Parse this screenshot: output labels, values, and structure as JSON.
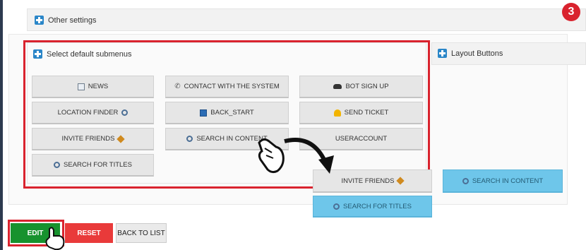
{
  "panels": {
    "other_settings": "Other settings",
    "select_default_submenus": "Select default submenus",
    "layout_buttons": "Layout Buttons"
  },
  "step_badge": "3",
  "submenus": {
    "news": "NEWS",
    "contact": "CONTACT WITH THE SYSTEM",
    "bot_signup": "BOT SIGN UP",
    "location_finder": "LOCATION FINDER",
    "back_start": "BACK_START",
    "send_ticket": "SEND TICKET",
    "invite_friends": "INVITE FRIENDS",
    "search_in_content": "SEARCH IN CONTENT",
    "useraccount": "USERACCOUNT",
    "search_for_titles": "SEARCH FOR TITLES"
  },
  "layout": {
    "invite_friends": "INVITE FRIENDS",
    "search_in_content": "SEARCH IN CONTENT",
    "search_for_titles": "SEARCH FOR TITLES"
  },
  "actions": {
    "edit": "EDIT",
    "reset": "RESET",
    "back_to_list": "BACK TO LIST"
  },
  "colors": {
    "accent_red": "#d9232e",
    "edit_green": "#17922e",
    "reset_red": "#e93a3a",
    "selected_blue": "#6ec6ea",
    "icon_blue": "#2a86c8"
  },
  "icons": [
    "plus-icon",
    "news-icon",
    "contact-icon",
    "bot-icon",
    "magnifier-icon",
    "back-icon",
    "bell-icon",
    "gift-icon",
    "hand-pointer-icon",
    "drag-arrow-icon"
  ]
}
